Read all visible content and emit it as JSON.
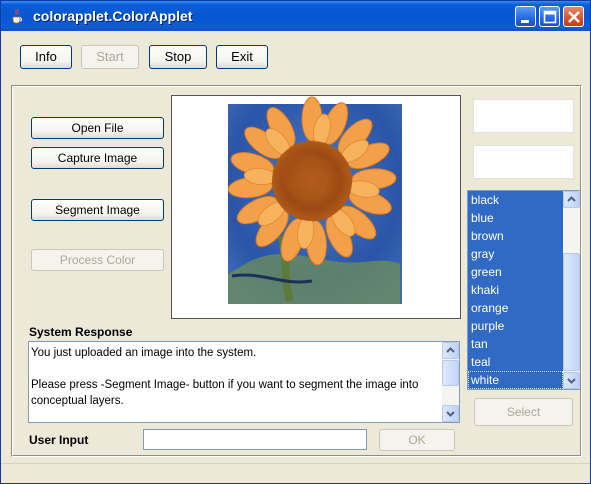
{
  "window": {
    "title": "colorapplet.ColorApplet"
  },
  "colors": {
    "title_bar": "#0556d1",
    "selection": "#316ac5",
    "window_bg": "#ece9d8"
  },
  "toolbar": {
    "info_label": "Info",
    "start_label": "Start",
    "stop_label": "Stop",
    "exit_label": "Exit"
  },
  "actions": {
    "open_file_label": "Open File",
    "capture_image_label": "Capture Image",
    "segment_image_label": "Segment Image",
    "process_color_label": "Process Color"
  },
  "image": {
    "subject": "sunflower painting"
  },
  "color_list": {
    "items": [
      "black",
      "blue",
      "brown",
      "gray",
      "green",
      "khaki",
      "orange",
      "purple",
      "tan",
      "teal",
      "white"
    ],
    "focused_item": "white",
    "select_label": "Select"
  },
  "system_response": {
    "label": "System Response",
    "line1": "You just uploaded an image into the system.",
    "line2": "Please press -Segment Image- button if you want to segment the image into conceptual layers."
  },
  "user_input": {
    "label": "User Input",
    "value": "",
    "ok_label": "OK"
  }
}
